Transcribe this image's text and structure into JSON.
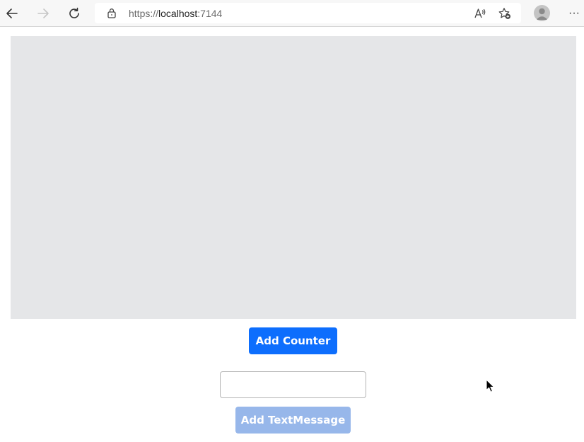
{
  "browser": {
    "url_scheme": "https://",
    "url_host": "localhost",
    "url_port": ":7144",
    "more_label": "···",
    "icons": {
      "back": "arrow-left-icon",
      "forward": "arrow-right-icon",
      "reload": "reload-icon",
      "lock": "lock-icon",
      "read_aloud": "read-aloud-icon",
      "favorite": "star-add-icon",
      "profile": "avatar-icon",
      "more": "ellipsis-icon"
    }
  },
  "main": {
    "add_counter_label": "Add Counter",
    "message_input_value": "",
    "add_text_message_label": "Add TextMessage"
  },
  "colors": {
    "primary_button": "#0d6efd",
    "disabled_button": "#97b7ea",
    "content_background": "#e5e6e8"
  }
}
